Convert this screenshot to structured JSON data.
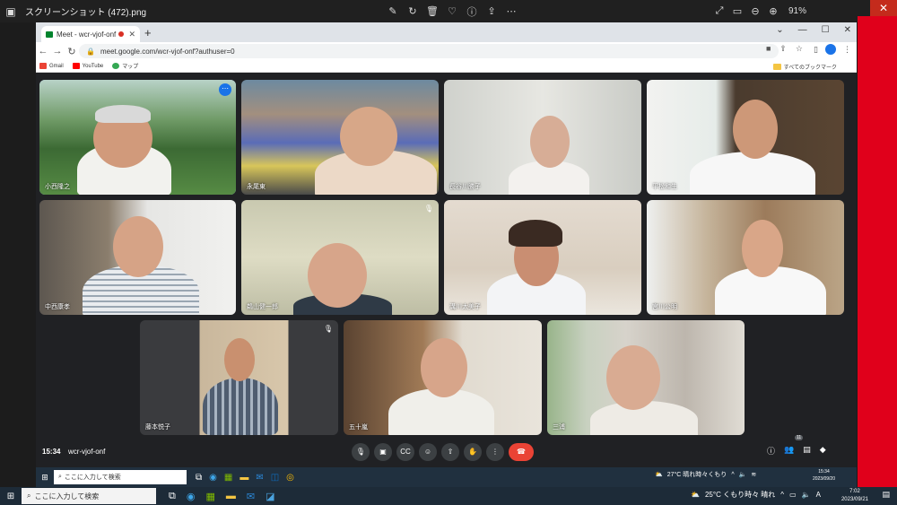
{
  "viewer": {
    "title": "スクリーンショット (472).png",
    "zoom": "91%",
    "icons": [
      "image-icon",
      "edit-icon",
      "rotate-icon",
      "delete-icon",
      "heart-icon",
      "info-icon",
      "share-icon",
      "more-icon"
    ]
  },
  "browser": {
    "tab_title": "Meet - wcr-vjof-onf",
    "url": "meet.google.com/wcr-vjof-onf?authuser=0",
    "bookmarks": [
      "Gmail",
      "YouTube",
      "マップ"
    ],
    "bookmarks_right": "すべてのブックマーク"
  },
  "meet": {
    "time": "15:34",
    "code": "wcr-vjof-onf",
    "participant_count": "11",
    "participants": [
      {
        "name": "小西隆之",
        "active": true,
        "muted": false
      },
      {
        "name": "永尾東",
        "active": false,
        "muted": false
      },
      {
        "name": "長谷川勝子",
        "active": false,
        "muted": false
      },
      {
        "name": "平松和生",
        "active": false,
        "muted": false
      },
      {
        "name": "中西康孝",
        "active": false,
        "muted": false
      },
      {
        "name": "鵜山健一郎",
        "active": false,
        "muted": true
      },
      {
        "name": "溝川太美子",
        "active": false,
        "muted": false
      },
      {
        "name": "宮川公明",
        "active": false,
        "muted": false
      },
      {
        "name": "藤本悦子",
        "active": false,
        "muted": true
      },
      {
        "name": "五十嵐",
        "active": false,
        "muted": false
      },
      {
        "name": "三浦",
        "active": false,
        "muted": false
      }
    ]
  },
  "inner_taskbar": {
    "search_placeholder": "ここに入力して検索",
    "weather": "27°C 晴れ時々くもり",
    "clock_time": "15:34",
    "clock_date": "2023/09/20"
  },
  "outer_taskbar": {
    "search_placeholder": "ここに入力して検索",
    "weather": "25°C くもり時々 晴れ",
    "clock_time": "7:02",
    "clock_date": "2023/09/21",
    "lang": "A"
  }
}
